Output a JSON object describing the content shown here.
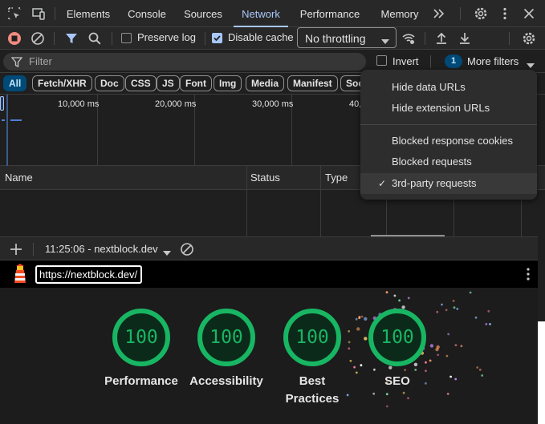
{
  "tabs": [
    "Elements",
    "Console",
    "Sources",
    "Network",
    "Performance",
    "Memory"
  ],
  "toolbar": {
    "preserve_log": "Preserve log",
    "disable_cache": "Disable cache",
    "throttling": "No throttling"
  },
  "filter": {
    "placeholder": "Filter",
    "invert": "Invert",
    "more_badge": "1",
    "more_filters": "More filters"
  },
  "chips": [
    "All",
    "Fetch/XHR",
    "Doc",
    "CSS",
    "JS",
    "Font",
    "Img",
    "Media",
    "Manifest",
    "Soc"
  ],
  "overview": {
    "ticks": [
      "10,000 ms",
      "20,000 ms",
      "30,000 ms",
      "40,"
    ]
  },
  "table": {
    "headers": [
      "Name",
      "Status",
      "Type"
    ]
  },
  "menu": {
    "items": [
      "Hide data URLs",
      "Hide extension URLs",
      "Blocked response cookies",
      "Blocked requests",
      "3rd-party requests"
    ],
    "checked": "3rd-party requests"
  },
  "drawer": {
    "report_label": "11:25:06 - nextblock.dev"
  },
  "lighthouse": {
    "url": "https://nextblock.dev/",
    "scores": [
      {
        "value": "100",
        "label": "Performance"
      },
      {
        "value": "100",
        "label": "Accessibility"
      },
      {
        "value": "100",
        "label": "Best Practices"
      },
      {
        "value": "100",
        "label": "SEO"
      }
    ]
  },
  "colors": {
    "accent": "#a8c7fa",
    "record_red": "#f28b82",
    "score_green": "#18b663"
  }
}
